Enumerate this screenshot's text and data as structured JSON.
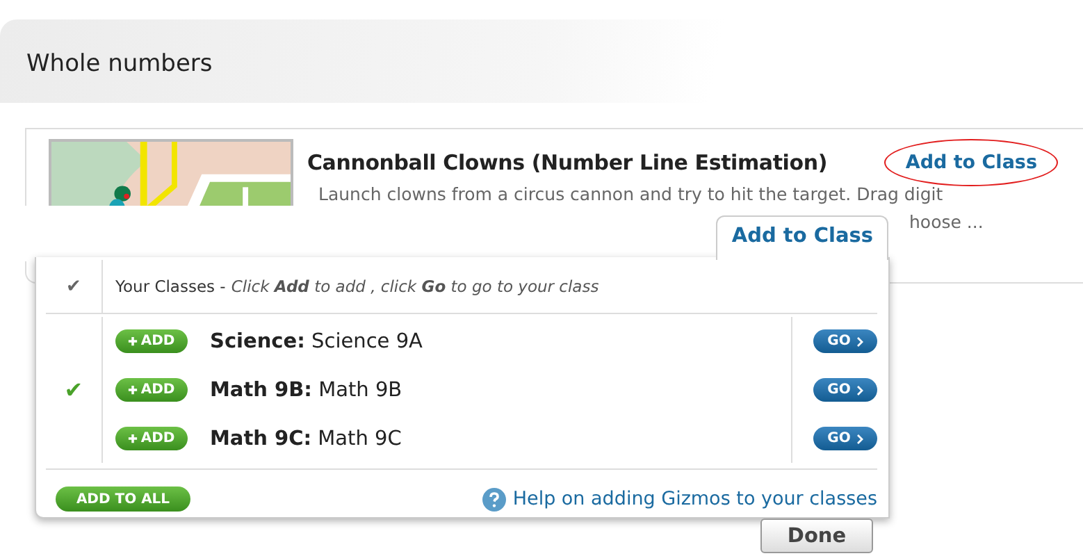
{
  "section_title": "Whole numbers",
  "gizmo": {
    "title": "Cannonball Clowns (Number Line Estimation)",
    "add_link": "Add to Class",
    "highlighted": true,
    "description_line_1": "Launch clowns from a circus cannon and try to hit the target. Drag digit",
    "description_line_2": "hoose ..."
  },
  "popup": {
    "tab": "Add to Class",
    "header_check": "✔",
    "header_label": "Your Classes - ",
    "header_hint": "*Click* **Add** *to add , click* **Go** *to go to your class*",
    "classes": [
      {
        "course": "Science:",
        "name": "Science 9A",
        "add": "ADD",
        "go": "GO",
        "checked": false
      },
      {
        "course": "Math 9B:",
        "name": "Math 9B",
        "add": "ADD",
        "go": "GO",
        "checked": true
      },
      {
        "course": "Math 9C:",
        "name": "Math 9C",
        "add": "ADD",
        "go": "GO",
        "checked": false
      }
    ],
    "add_all": "ADD TO ALL",
    "help": "Help on adding Gizmos to your classes"
  },
  "done": "Done"
}
